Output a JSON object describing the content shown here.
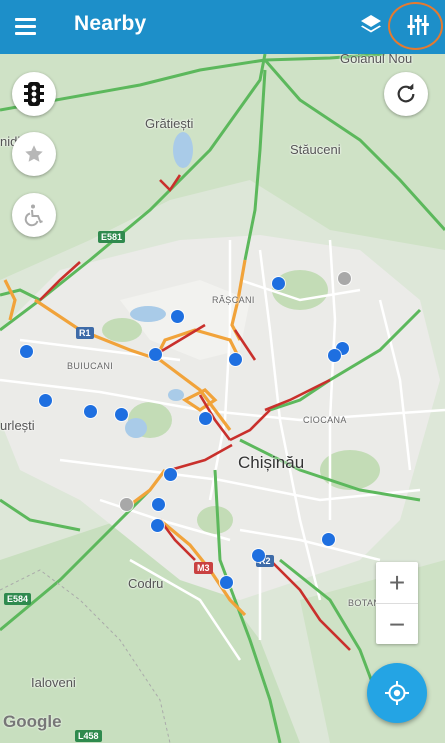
{
  "appbar": {
    "title": "Nearby"
  },
  "icons": {
    "menu": "hamburger-menu",
    "layers": "layers",
    "filter": "sliders-filter",
    "traffic": "traffic-light",
    "favorites": "star",
    "accessibility": "wheelchair",
    "refresh": "refresh",
    "locate": "gps-crosshair"
  },
  "colors": {
    "appbar": "#1d8fc9",
    "locate_button": "#24a4e4",
    "highlight_ring": "#e57a2f",
    "stop_active": "#1e6fe0",
    "stop_inactive": "#a8a8a8",
    "traffic_green": "#5cb85c",
    "traffic_orange": "#f1a33a",
    "traffic_red": "#c9302c"
  },
  "map": {
    "labels": {
      "golandi_nou": "Goianul Nou",
      "gratiesti": "Grătiești",
      "stauceni": "Stăuceni",
      "hidi": "nidi",
      "rascani": "RÂȘCANI",
      "buiucani": "BUIUCANI",
      "durlesti": "urlești",
      "ciocana": "CIOCANA",
      "chisinau": "Chișinău",
      "codru": "Codru",
      "botanica": "BOTANICA",
      "ialoveni": "Ialoveni"
    },
    "roads": {
      "e581": "E581",
      "r1": "R1",
      "r2": "R2",
      "m3": "M3",
      "e584": "E584",
      "l458": "L458"
    },
    "attribution": "Google"
  },
  "zoom": {
    "plus": "+",
    "minus": "−"
  },
  "stops": {
    "active_count": 18,
    "inactive_count": 2
  }
}
